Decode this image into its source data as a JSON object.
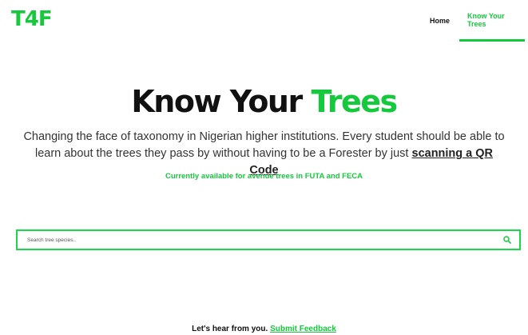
{
  "brand": {
    "logo_text": "T4F",
    "accent_color": "#14c93c"
  },
  "nav": {
    "items": [
      {
        "label": "Home",
        "active": false
      },
      {
        "label": "Know Your Trees",
        "active": true
      }
    ]
  },
  "hero": {
    "title_part1": "Know Your",
    "title_part2": "Trees",
    "description_line1": "Changing the face of taxonomy in Nigerian higher institutions. Every student should be able to learn about the trees they pass by without having to be a Forester by just",
    "qr_link_label": "scanning a QR Code",
    "availability": "Currently available for avenue trees in FUTA and FECA"
  },
  "search": {
    "placeholder": "Search tree species..",
    "value": "",
    "icon": "search-icon"
  },
  "footer": {
    "prompt": "Let's hear from you.",
    "feedback_link_label": "Submit Feedback"
  }
}
